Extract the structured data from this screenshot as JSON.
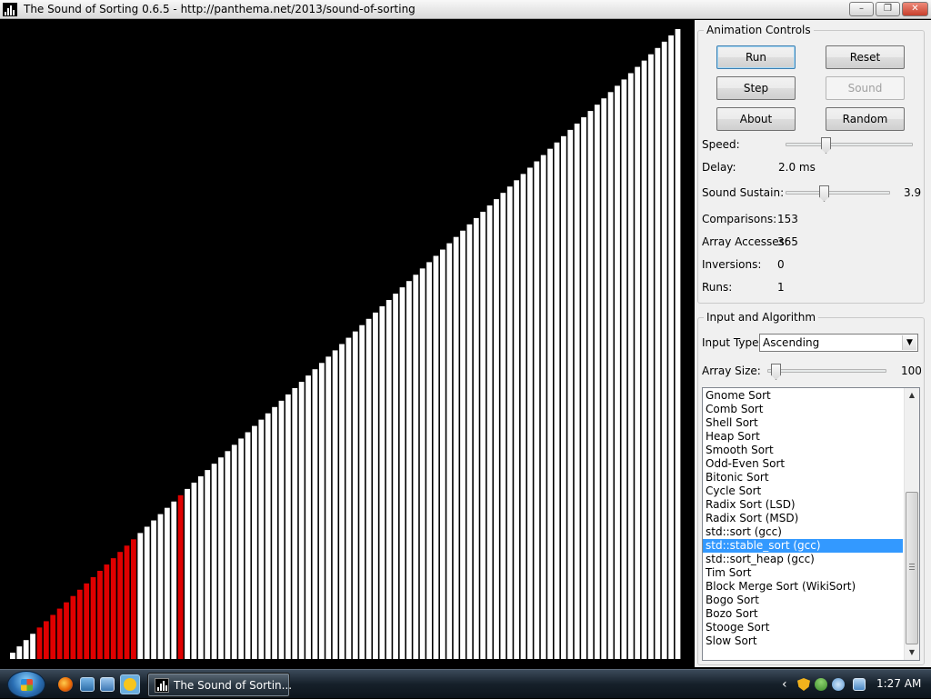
{
  "window": {
    "title": "The Sound of Sorting 0.6.5 - http://panthema.net/2013/sound-of-sorting",
    "minimize_glyph": "–",
    "maximize_glyph": "❐",
    "close_glyph": "✕"
  },
  "visualization": {
    "array_size": 100,
    "values_ascending_1_to_100": true,
    "highlighted_red_indices": [
      4,
      5,
      6,
      7,
      8,
      9,
      10,
      11,
      12,
      13,
      14,
      15,
      16,
      17,
      18,
      25
    ],
    "colors": {
      "background": "#000000",
      "bar": "#ffffff",
      "highlight": "#e00000"
    }
  },
  "animation_controls": {
    "title": "Animation Controls",
    "buttons": {
      "run": "Run",
      "reset": "Reset",
      "step": "Step",
      "sound": "Sound",
      "about": "About",
      "random": "Random"
    },
    "speed_label": "Speed:",
    "delay_label": "Delay:",
    "delay_value": "2.0 ms",
    "sound_sustain_label": "Sound Sustain:",
    "sound_sustain_value": "3.9",
    "comparisons_label": "Comparisons:",
    "comparisons_value": "153",
    "array_accesses_label": "Array Accesses:",
    "array_accesses_value": "365",
    "inversions_label": "Inversions:",
    "inversions_value": "0",
    "runs_label": "Runs:",
    "runs_value": "1"
  },
  "input_algorithm": {
    "title": "Input and Algorithm",
    "input_type_label": "Input Type:",
    "input_type_value": "Ascending",
    "array_size_label": "Array Size:",
    "array_size_value": "100",
    "algorithms": [
      "Gnome Sort",
      "Comb Sort",
      "Shell Sort",
      "Heap Sort",
      "Smooth Sort",
      "Odd-Even Sort",
      "Bitonic Sort",
      "Cycle Sort",
      "Radix Sort (LSD)",
      "Radix Sort (MSD)",
      "std::sort (gcc)",
      "std::stable_sort (gcc)",
      "std::sort_heap (gcc)",
      "Tim Sort",
      "Block Merge Sort (WikiSort)",
      "Bogo Sort",
      "Bozo Sort",
      "Stooge Sort",
      "Slow Sort"
    ],
    "selected_algorithm": "std::stable_sort (gcc)"
  },
  "taskbar": {
    "task_label": "The Sound of Sortin...",
    "tray_chevron": "‹",
    "clock": "1:27 AM"
  }
}
